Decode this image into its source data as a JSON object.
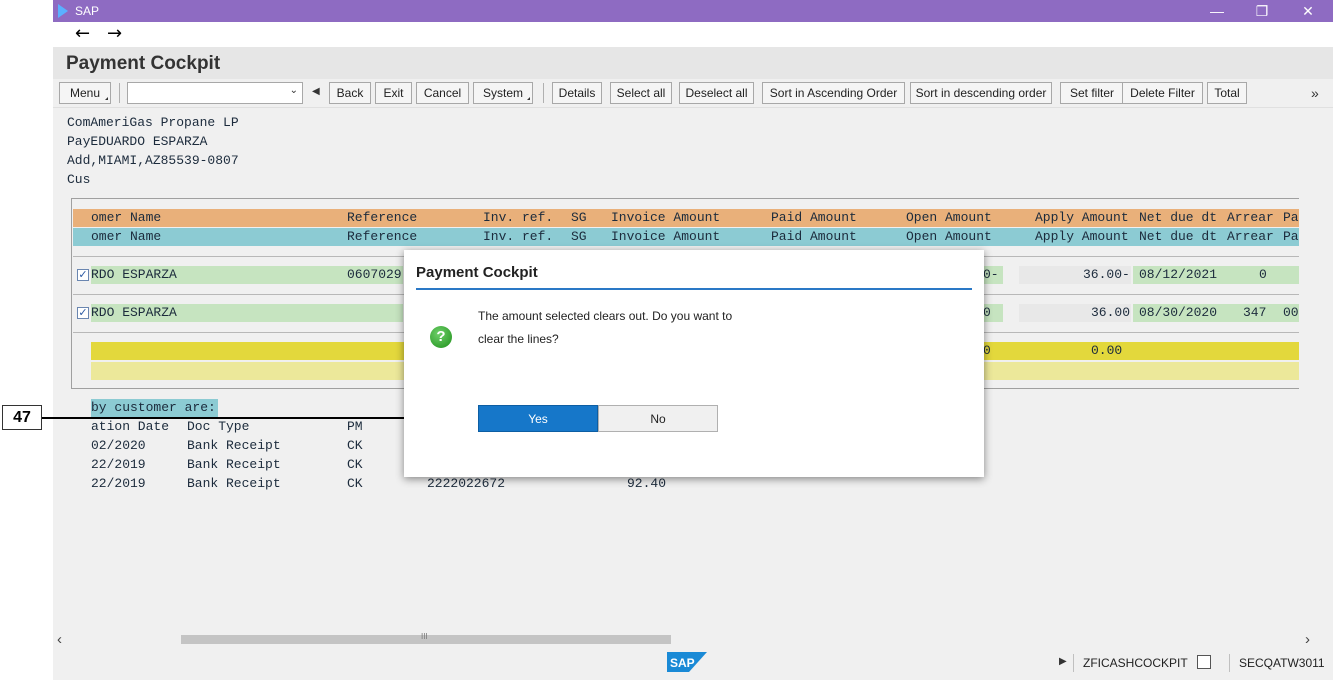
{
  "window": {
    "title": "SAP",
    "minimize": "—",
    "restore": "❐",
    "close": "✕"
  },
  "nav": {
    "back_arrow": "←",
    "forward_arrow": "→"
  },
  "page": {
    "title": "Payment Cockpit"
  },
  "toolbar": {
    "menu": "Menu",
    "back": "Back",
    "exit": "Exit",
    "cancel": "Cancel",
    "system": "System",
    "details": "Details",
    "select_all": "Select all",
    "deselect_all": "Deselect all",
    "sort_asc": "Sort in Ascending Order",
    "sort_desc": "Sort in descending order",
    "set_filter": "Set filter",
    "delete_filter": "Delete Filter",
    "total": "Total",
    "more": "»",
    "combo_value": ""
  },
  "address": {
    "line1": "ComAmeriGas Propane LP",
    "line2": "PayEDUARDO ESPARZA",
    "line3": "Add,MIAMI,AZ85539-0807",
    "line4": "Cus"
  },
  "grid": {
    "headers": [
      "omer Name",
      "Reference",
      "Inv. ref.",
      "SG",
      "Invoice Amount",
      "Paid Amount",
      "Open Amount",
      "Apply Amount",
      "Net due dt",
      "Arrear",
      "Pa"
    ],
    "rows": [
      {
        "name": "RDO ESPARZA",
        "reference": "0607029",
        "open_tail": "0-",
        "apply": "36.00-",
        "net_due": "08/12/2021",
        "arrear": "0",
        "pa": ""
      },
      {
        "name": "RDO ESPARZA",
        "reference": "",
        "open_tail": "0",
        "apply": "36.00",
        "net_due": "08/30/2020",
        "arrear": "347",
        "pa": "00"
      }
    ],
    "total_open_tail": "0",
    "total_apply": "0.00"
  },
  "payments": {
    "heading": "by customer are:",
    "col_date": "ation Date",
    "col_doctype": "Doc Type",
    "col_pm": "PM",
    "rows": [
      {
        "date": "02/2020",
        "doctype": "Bank Receipt",
        "pm": "CK",
        "ref": "",
        "amount": ""
      },
      {
        "date": "22/2019",
        "doctype": "Bank Receipt",
        "pm": "CK",
        "ref": "",
        "amount": ""
      },
      {
        "date": "22/2019",
        "doctype": "Bank Receipt",
        "pm": "CK",
        "ref": "2222022672",
        "amount": "92.40"
      }
    ]
  },
  "scroll": {
    "left": "‹",
    "right": "›",
    "grip": "III"
  },
  "status": {
    "transaction": "ZFICASHCOCKPIT",
    "system": "SECQATW3011",
    "play": "▶"
  },
  "dialog": {
    "title": "Payment Cockpit",
    "message_line1": "The amount selected clears out. Do you want to",
    "message_line2": "clear the lines?",
    "icon": "?",
    "yes": "Yes",
    "no": "No"
  },
  "annotation": {
    "label": "47"
  }
}
